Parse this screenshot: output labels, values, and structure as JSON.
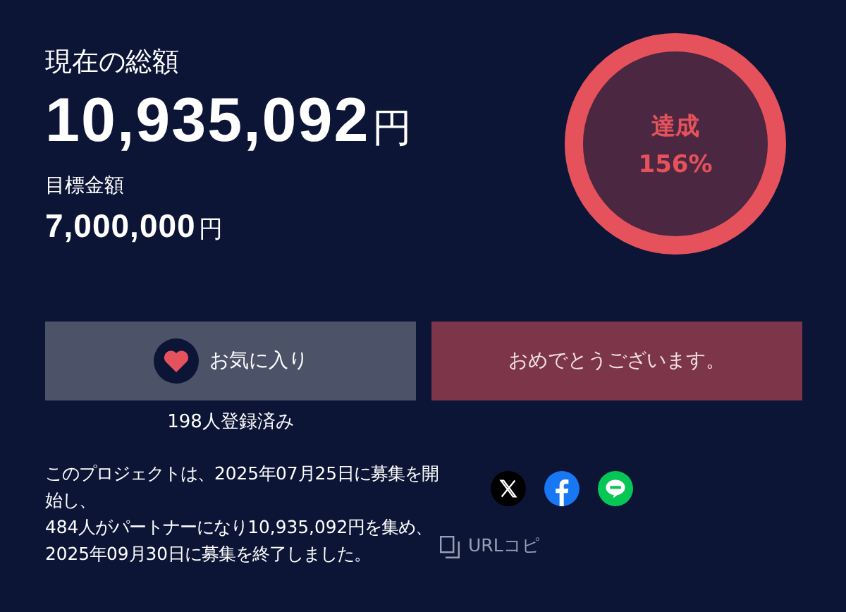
{
  "total": {
    "label": "現在の総額",
    "amount": "10,935,092",
    "unit": "円"
  },
  "goal": {
    "label": "目標金額",
    "amount": "7,000,000",
    "unit": "円"
  },
  "achievement": {
    "label": "達成",
    "percent": "156%",
    "level": 1
  },
  "favorite_button": {
    "label": "お気に入り",
    "count": "198人登録済み"
  },
  "congrats_button": {
    "label": "おめでとうございます。"
  },
  "description": [
    "このプロジェクトは、2025年07月25日に募集を開始し、",
    "484人がパートナーになり10,935,092円を集め、",
    "2025年09月30日に募集を終了しました。"
  ],
  "share": [
    {
      "kind": "x"
    },
    {
      "kind": "facebook"
    },
    {
      "kind": "line"
    }
  ],
  "url_copy": {
    "label": "URLコピ"
  }
}
